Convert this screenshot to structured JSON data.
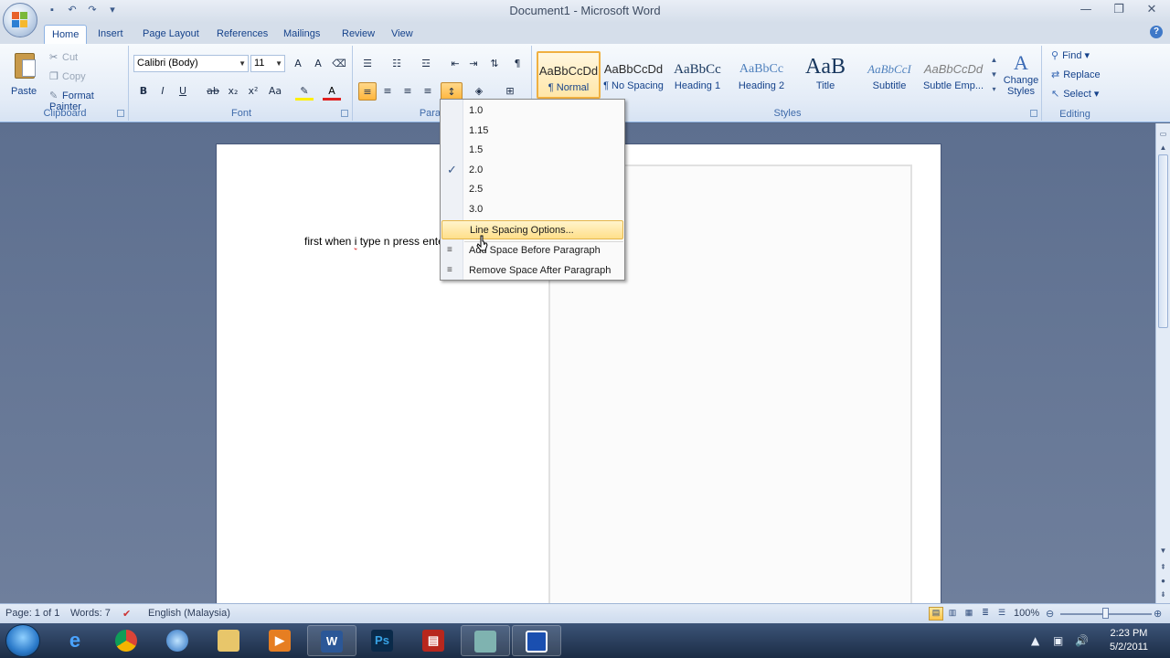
{
  "window": {
    "title": "Document1 - Microsoft Word",
    "controls": [
      "—",
      "❐",
      "✕"
    ]
  },
  "tabs": [
    "Home",
    "Insert",
    "Page Layout",
    "References",
    "Mailings",
    "Review",
    "View"
  ],
  "clipboard": {
    "paste": "Paste",
    "cut": "Cut",
    "copy": "Copy",
    "format_painter": "Format Painter",
    "label": "Clipboard"
  },
  "font": {
    "name": "Calibri (Body)",
    "size": "11",
    "label": "Font"
  },
  "paragraph": {
    "label": "Paragraph"
  },
  "styles": {
    "label": "Styles",
    "items": [
      {
        "sample": "AaBbCcDd",
        "name": "¶ Normal"
      },
      {
        "sample": "AaBbCcDd",
        "name": "¶ No Spacing"
      },
      {
        "sample": "AaBbCc",
        "name": "Heading 1"
      },
      {
        "sample": "AaBbCc",
        "name": "Heading 2"
      },
      {
        "sample": "AaB",
        "name": "Title"
      },
      {
        "sample": "AaBbCcI",
        "name": "Subtitle"
      },
      {
        "sample": "AaBbCcDd",
        "name": "Subtle Emp..."
      }
    ],
    "change_styles": [
      "Change",
      "Styles"
    ]
  },
  "editing": {
    "label": "Editing",
    "find": "Find",
    "replace": "Replace",
    "select": "Select"
  },
  "document": {
    "text_before": "first when ",
    "text_word": "i",
    "text_after": " type n press enter,"
  },
  "line_spacing_menu": {
    "options": [
      "1.0",
      "1.15",
      "1.5",
      "2.0",
      "2.5",
      "3.0"
    ],
    "checked": "2.0",
    "options_item": "Line Spacing Options...",
    "add_before": "Add Space Before Paragraph",
    "remove_after": "Remove Space After Paragraph"
  },
  "statusbar": {
    "page": "Page: 1 of 1",
    "words": "Words: 7",
    "language": "English (Malaysia)",
    "zoom": "100%"
  },
  "taskbar": {
    "time": "2:23 PM",
    "date": "5/2/2011"
  },
  "colors": {
    "ribbon_text": "#15428b",
    "highlight": "#ffdf8a",
    "doc_bg": "#6f7f9c"
  }
}
